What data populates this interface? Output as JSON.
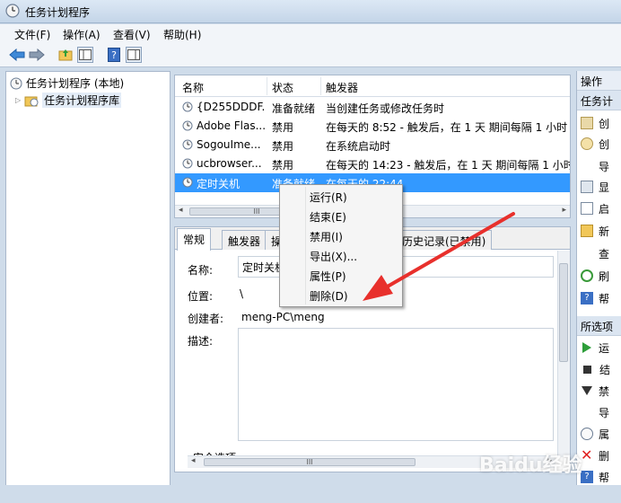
{
  "window": {
    "title": "任务计划程序"
  },
  "menu": [
    "文件(F)",
    "操作(A)",
    "查看(V)",
    "帮助(H)"
  ],
  "tree": {
    "root": "任务计划程序 (本地)",
    "child": "任务计划程序库"
  },
  "task_list": {
    "columns": [
      "名称",
      "状态",
      "触发器"
    ],
    "rows": [
      {
        "name": "{D255DDDF...",
        "status": "准备就绪",
        "trigger": "当创建任务或修改任务时"
      },
      {
        "name": "Adobe Flas...",
        "status": "禁用",
        "trigger": "在每天的 8:52 - 触发后，在 1 天 期间每隔 1 小时"
      },
      {
        "name": "SogouIme...",
        "status": "禁用",
        "trigger": "在系统启动时"
      },
      {
        "name": "ucbrowser...",
        "status": "禁用",
        "trigger": "在每天的 14:23 - 触发后，在 1 天 期间每隔 1 小时"
      },
      {
        "name": "定时关机",
        "status": "准备就绪",
        "trigger": "在每天的 22:44"
      }
    ],
    "selected_index": 4,
    "scroll_marker": "III"
  },
  "detail": {
    "tabs": [
      "常规",
      "触发器",
      "操",
      "历史记录(已禁用)"
    ],
    "labels": {
      "name": "名称:",
      "location": "位置:",
      "author": "创建者:",
      "description": "描述:",
      "security": "安全选项"
    },
    "values": {
      "name": "定时关机",
      "location": "\\",
      "author": "meng-PC\\meng"
    },
    "scroll_marker": "III"
  },
  "context_menu": {
    "items": [
      "运行(R)",
      "结束(E)",
      "禁用(I)",
      "导出(X)...",
      "属性(P)",
      "删除(D)"
    ]
  },
  "actions_panel": {
    "header": "操作",
    "section1": "任务计",
    "items1": [
      "创",
      "创",
      "导",
      "显",
      "启",
      "新",
      "查",
      "刷",
      "帮"
    ],
    "section2": "所选项",
    "items2": [
      "运",
      "结",
      "禁",
      "导",
      "属",
      "删",
      "帮"
    ]
  },
  "watermark": "Baidu经验",
  "colors": {
    "selection": "#3399ff",
    "arrow": "#e8302c",
    "delete_icon": "#e02020"
  }
}
